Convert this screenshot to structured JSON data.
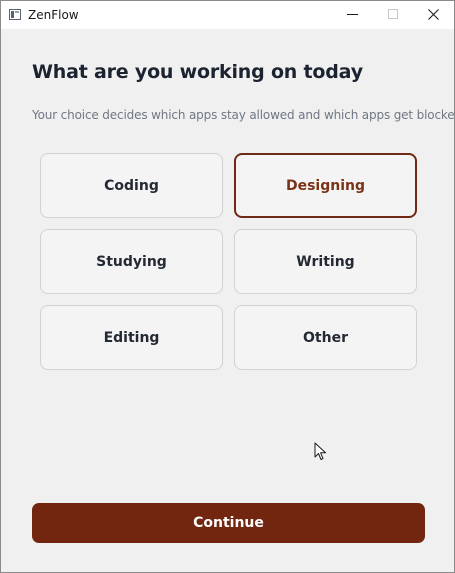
{
  "window": {
    "title": "ZenFlow"
  },
  "main": {
    "heading": "What are you working on today",
    "subtitle": "Your choice decides which apps stay allowed and which apps get blocked",
    "options": [
      {
        "label": "Coding",
        "selected": false
      },
      {
        "label": "Designing",
        "selected": true
      },
      {
        "label": "Studying",
        "selected": false
      },
      {
        "label": "Writing",
        "selected": false
      },
      {
        "label": "Editing",
        "selected": false
      },
      {
        "label": "Other",
        "selected": false
      }
    ],
    "continue_label": "Continue"
  },
  "colors": {
    "accent": "#722610",
    "selected_border": "#6e2a14",
    "background": "#f0f0f0"
  }
}
